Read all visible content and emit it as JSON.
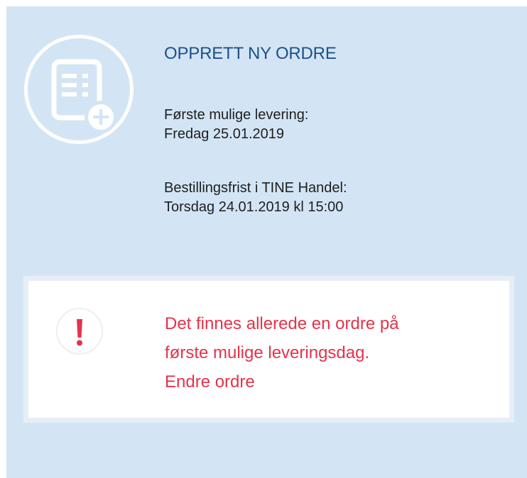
{
  "order_card": {
    "icon": "new-order-document-plus-icon",
    "title": "OPPRETT NY ORDRE",
    "first_delivery": {
      "label": "Første mulige levering:",
      "value": "Fredag 25.01.2019"
    },
    "order_deadline": {
      "label": "Bestillingsfrist i TINE Handel:",
      "value": "Torsdag 24.01.2019 kl 15:00"
    }
  },
  "alert": {
    "icon": "exclamation-icon",
    "message_line1": "Det finnes allerede en ordre på",
    "message_line2": "første mulige leveringsdag.",
    "edit_link": "Endre ordre"
  },
  "colors": {
    "card_background": "#d3e5f5",
    "title": "#1f4f8a",
    "alert_text": "#e4334a",
    "alert_border": "#e7eef5"
  }
}
